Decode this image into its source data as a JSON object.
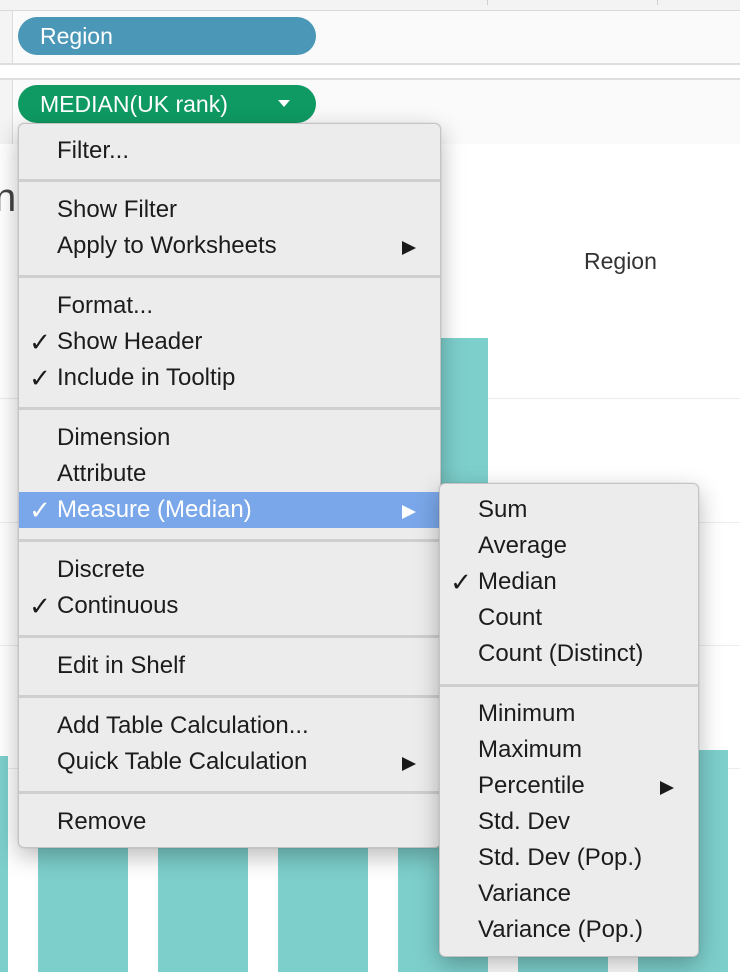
{
  "shelves": {
    "columns_pill": "Region",
    "rows_pill": "MEDIAN(UK rank)"
  },
  "worksheet": {
    "title_fragment": "nk",
    "column_header": "Region"
  },
  "context_menu": {
    "filter": "Filter...",
    "show_filter": "Show Filter",
    "apply_to_worksheets": "Apply to Worksheets",
    "format": "Format...",
    "show_header": "Show Header",
    "include_in_tooltip": "Include in Tooltip",
    "dimension": "Dimension",
    "attribute": "Attribute",
    "measure_median": "Measure (Median)",
    "discrete": "Discrete",
    "continuous": "Continuous",
    "edit_in_shelf": "Edit in Shelf",
    "add_table_calculation": "Add Table Calculation...",
    "quick_table_calculation": "Quick Table Calculation",
    "remove": "Remove",
    "checkmark": "✓"
  },
  "measure_submenu": {
    "sum": "Sum",
    "average": "Average",
    "median": "Median",
    "count": "Count",
    "count_distinct": "Count (Distinct)",
    "minimum": "Minimum",
    "maximum": "Maximum",
    "percentile": "Percentile",
    "std_dev": "Std. Dev",
    "std_dev_pop": "Std. Dev (Pop.)",
    "variance": "Variance",
    "variance_pop": "Variance (Pop.)",
    "checkmark": "✓"
  },
  "colors": {
    "region_pill": "#4a97b7",
    "measure_pill": "#0f9a63",
    "bars": "#7dcfcc",
    "menu_highlight": "#7aa7e9"
  }
}
